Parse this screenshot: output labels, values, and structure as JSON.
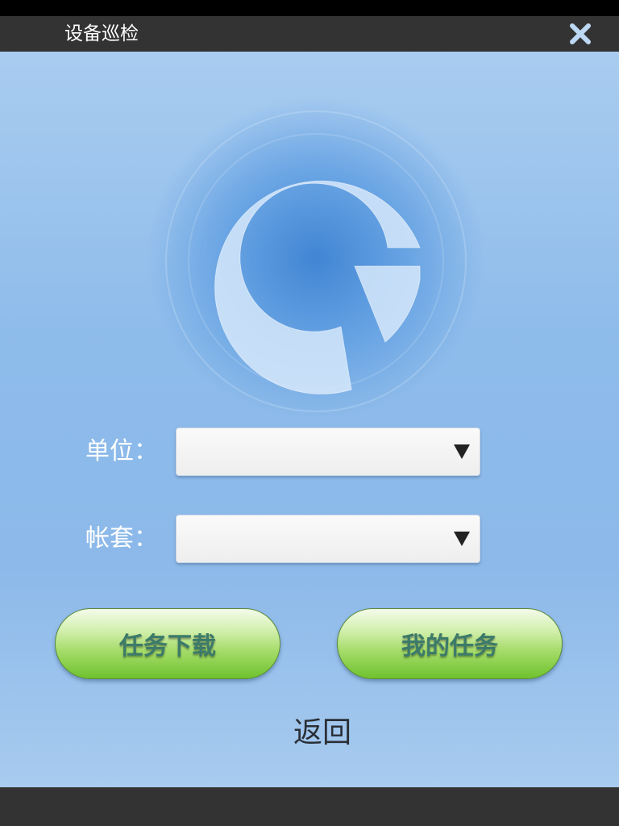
{
  "header": {
    "title": "设备巡检",
    "close_icon": "close-icon"
  },
  "logo": {
    "icon": "q-ring-logo-icon"
  },
  "form": {
    "unit": {
      "label": "单位：",
      "value": ""
    },
    "account_set": {
      "label": "帐套：",
      "value": ""
    }
  },
  "actions": {
    "download_tasks_label": "任务下载",
    "my_tasks_label": "我的任务",
    "return_label": "返回"
  },
  "colors": {
    "title_bar": "#333333",
    "button_green": "#6ec22e",
    "button_text": "#3c7a6a",
    "background_blue": "#8dbbea"
  }
}
